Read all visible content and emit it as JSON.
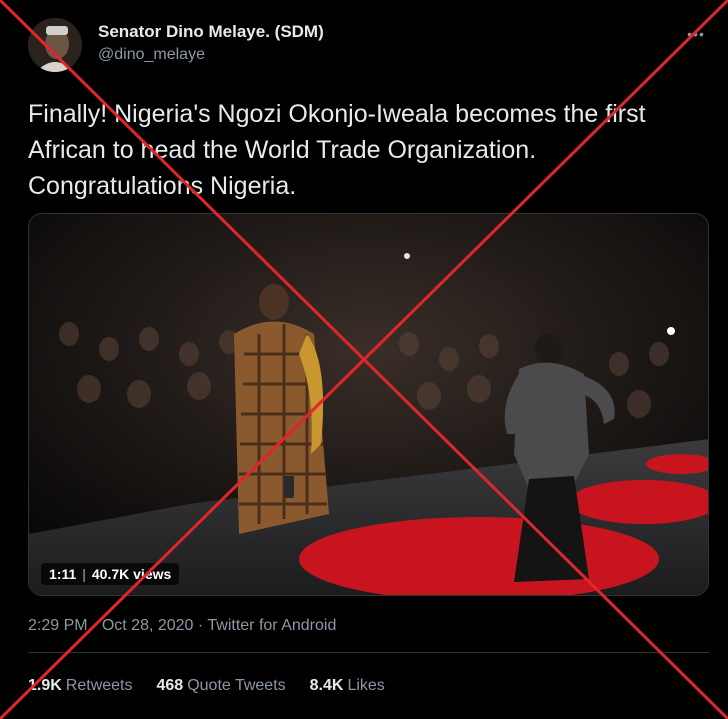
{
  "author": {
    "display_name": "Senator Dino Melaye. (SDM)",
    "handle": "@dino_melaye"
  },
  "more_icon": "ellipsis-icon",
  "tweet": {
    "lines": [
      "Finally! Nigeria's Ngozi Okonjo-Iweala becomes the first",
      "African to head the World Trade Organization.",
      "Congratulations Nigeria."
    ]
  },
  "video": {
    "duration": "1:11",
    "views": "40.7K views"
  },
  "meta": {
    "time": "2:29 PM",
    "separator": "·",
    "date": "Oct 28, 2020",
    "source": "Twitter for Android"
  },
  "stats": {
    "retweets": {
      "count": "1.9K",
      "label": "Retweets"
    },
    "quote_tweets": {
      "count": "468",
      "label": "Quote Tweets"
    },
    "likes": {
      "count": "8.4K",
      "label": "Likes"
    }
  },
  "colors": {
    "background": "#000000",
    "overlay_cross": "#e0262b",
    "stage_red": "#c8141f"
  }
}
